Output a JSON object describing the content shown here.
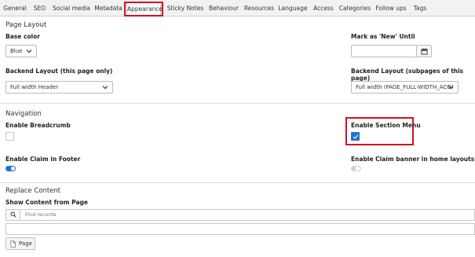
{
  "tabs": [
    {
      "label": "General"
    },
    {
      "label": "SEO"
    },
    {
      "label": "Social media"
    },
    {
      "label": "Metadata"
    },
    {
      "label": "Appearance",
      "active": true
    },
    {
      "label": "Sticky Notes"
    },
    {
      "label": "Behaviour"
    },
    {
      "label": "Resources"
    },
    {
      "label": "Language"
    },
    {
      "label": "Access"
    },
    {
      "label": "Categories"
    },
    {
      "label": "Follow ups"
    },
    {
      "label": "Tags"
    }
  ],
  "page_layout": {
    "title": "Page Layout",
    "base_color_label": "Base color",
    "base_color_value": "Blue",
    "mark_new_label": "Mark as 'New' Until",
    "mark_new_value": "",
    "backend_layout_label": "Backend Layout (this page only)",
    "backend_layout_value": "Full width Header",
    "backend_layout_sub_label": "Backend Layout (subpages of this page)",
    "backend_layout_sub_value": "Full width (PAGE_FULL-WIDTH_ACO)"
  },
  "navigation": {
    "title": "Navigation",
    "enable_breadcrumb_label": "Enable Breadcrumb",
    "enable_breadcrumb_checked": false,
    "enable_section_menu_label": "Enable Section Menu",
    "enable_section_menu_checked": true,
    "enable_claim_footer_label": "Enable Claim in Footer",
    "enable_claim_footer_on": true,
    "enable_claim_banner_label": "Enable Claim banner in home layouts",
    "enable_claim_banner_on": false
  },
  "replace_content": {
    "title": "Replace Content",
    "show_content_label": "Show Content from Page",
    "search_placeholder": "Find records",
    "page_button_label": "Page"
  },
  "colors": {
    "accent": "#1f76d2",
    "highlight": "#d60f20"
  }
}
